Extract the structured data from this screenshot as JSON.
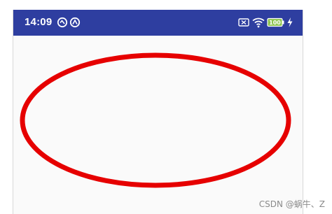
{
  "status_bar": {
    "time": "14:09",
    "background_color": "#2e3ea0",
    "battery_level": "100",
    "icons": [
      "notification-icon-1",
      "notification-icon-2",
      "no-sim-icon",
      "wifi-icon",
      "battery-icon",
      "charging-icon"
    ]
  },
  "canvas": {
    "shape": "oval",
    "stroke_color": "#e60000",
    "background_color": "#fafafa"
  },
  "watermark": {
    "text": "CSDN @蜗牛、Z"
  }
}
